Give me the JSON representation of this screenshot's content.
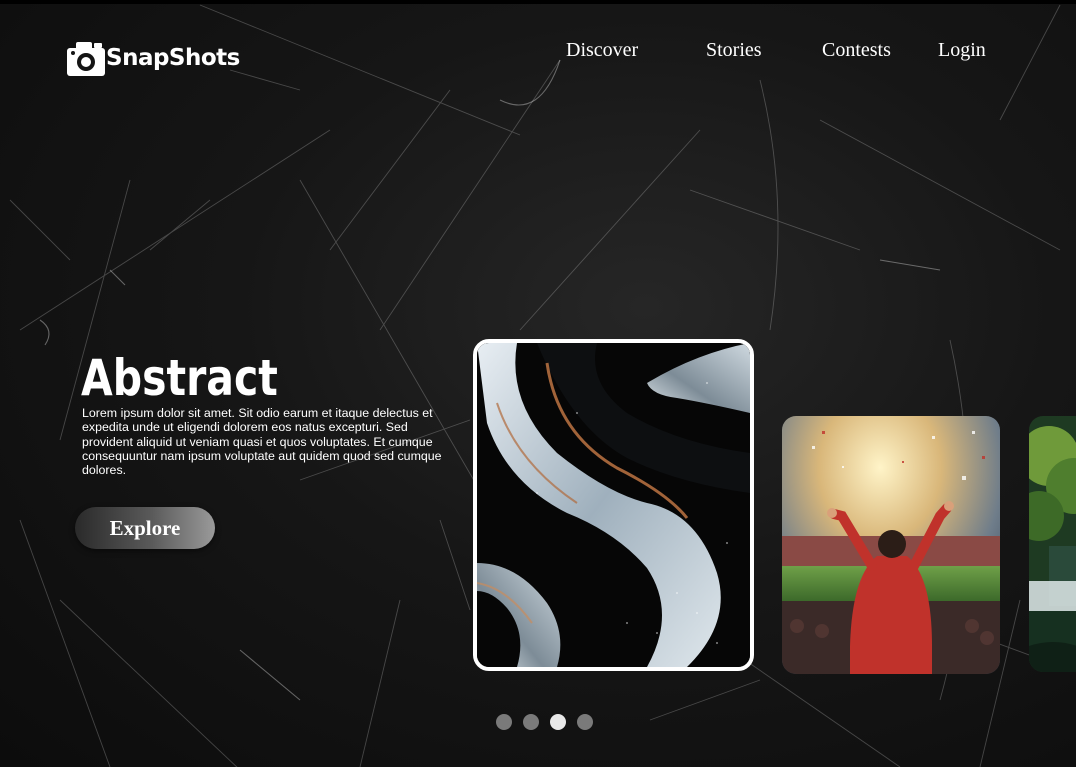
{
  "brand": {
    "name": "SnapShots",
    "logo_icon": "camera-icon"
  },
  "nav": {
    "items": [
      {
        "label": "Discover"
      },
      {
        "label": "Stories"
      },
      {
        "label": "Contests"
      },
      {
        "label": "Login"
      }
    ]
  },
  "hero": {
    "title": "Abstract",
    "description": "Lorem ipsum dolor sit amet. Sit odio earum et itaque delectus et expedita unde ut eligendi dolorem eos natus excepturi. Sed provident aliquid ut veniam quasi et quos voluptates. Et cumque consequuntur nam ipsum voluptate aut quidem quod sed cumque dolores.",
    "button_label": "Explore"
  },
  "carousel": {
    "cards": [
      {
        "subject": "abstract liquid metal",
        "selected": true
      },
      {
        "subject": "stadium fan celebrating",
        "selected": false
      },
      {
        "subject": "forest waterfall",
        "selected": false
      }
    ],
    "dots": 4,
    "active_dot": 3
  },
  "colors": {
    "background": "#141414",
    "text": "#ffffff",
    "dot_inactive": "#7a7a7a",
    "dot_active": "#e8e8e8"
  }
}
